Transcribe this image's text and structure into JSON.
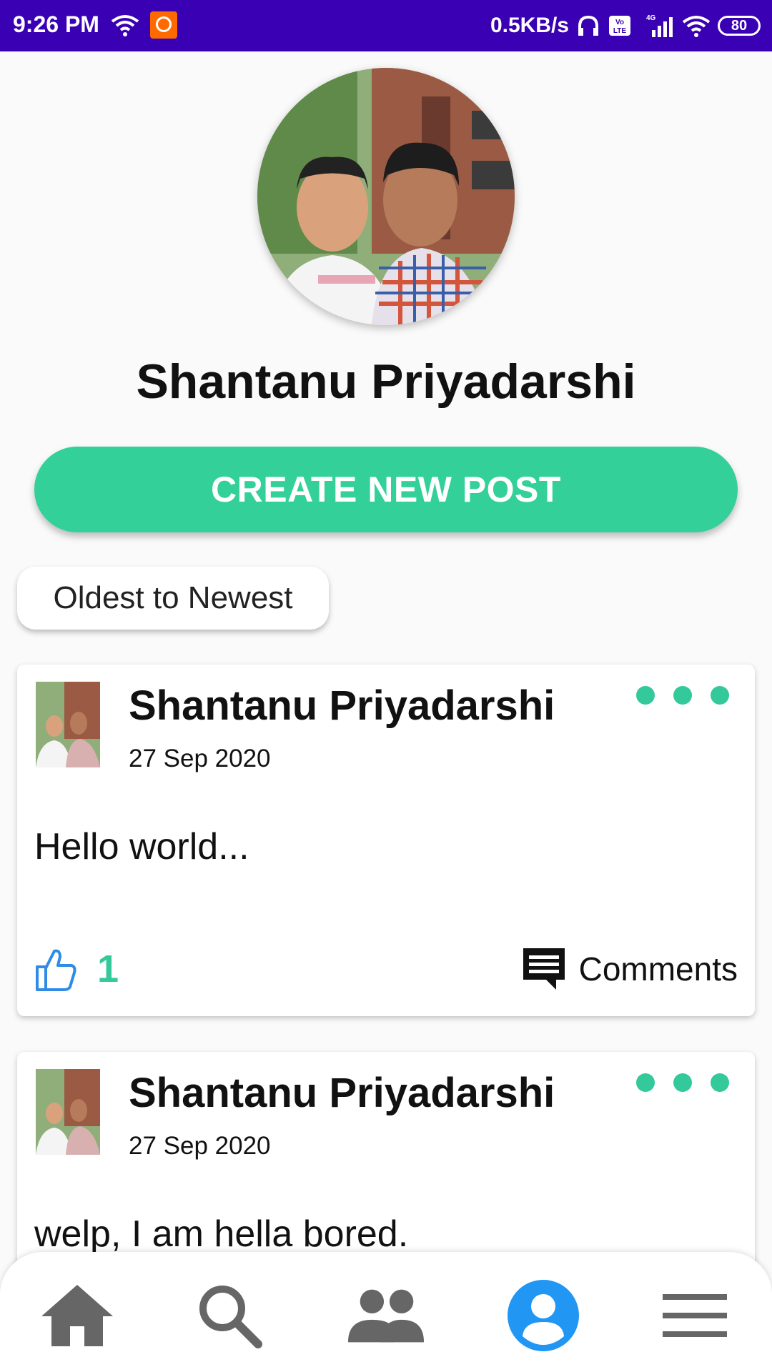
{
  "status_bar": {
    "time": "9:26 PM",
    "network_speed": "0.5KB/s",
    "network_type": "4G",
    "volte": "Vo LTE",
    "battery": "80",
    "icons": [
      "wifi-icon",
      "mi-app-icon",
      "headset-icon",
      "volte-icon",
      "signal-icon",
      "wifi-icon",
      "battery-icon"
    ]
  },
  "profile": {
    "name": "Shantanu Priyadarshi",
    "create_button_label": "CREATE NEW POST"
  },
  "sort": {
    "label": "Oldest to Newest"
  },
  "colors": {
    "status_bar": "#3a00b3",
    "accent": "#33d09a",
    "like_blue": "#2f8be6",
    "nav_active": "#2196f3",
    "nav_inactive": "#666666"
  },
  "posts": [
    {
      "author": "Shantanu Priyadarshi",
      "date": "27 Sep 2020",
      "body": "Hello world...",
      "likes": "1",
      "comments_label": "Comments"
    },
    {
      "author": "Shantanu Priyadarshi",
      "date": "27 Sep 2020",
      "body": "welp, I am hella bored."
    }
  ],
  "bottom_nav": {
    "items": [
      "home-icon",
      "search-icon",
      "people-icon",
      "profile-icon",
      "menu-icon"
    ],
    "active": "profile-icon"
  }
}
